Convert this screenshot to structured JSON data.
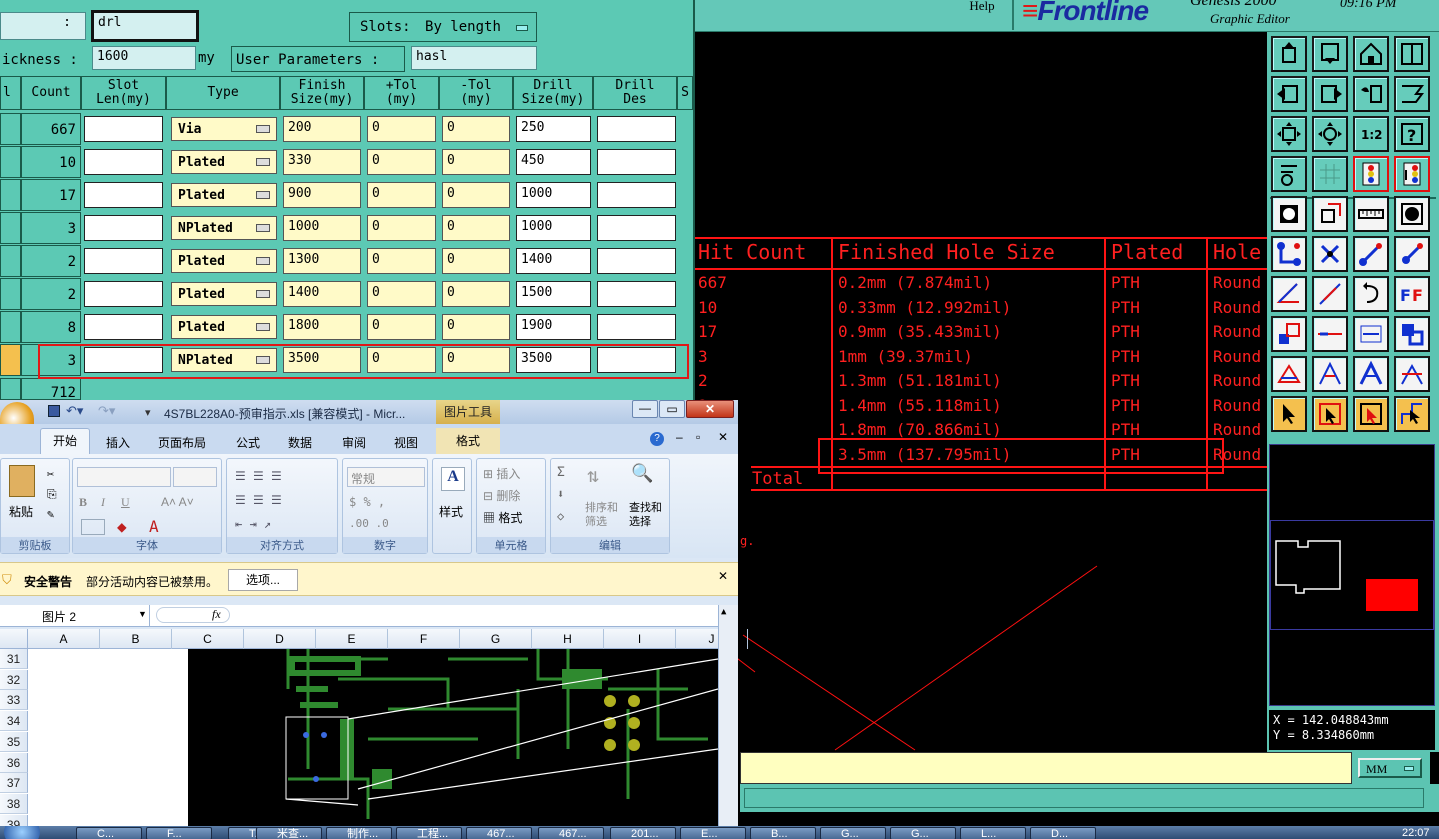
{
  "genesis": {
    "help_label": "Help",
    "logo": "Frontline",
    "app_name": "Genesis 2000",
    "subtitle": "Graphic Editor",
    "clock": "09:16 PM",
    "coord_x": "X = 142.048843mm",
    "coord_y": "Y = 8.334860mm",
    "units": "MM",
    "drill_table": {
      "headers": [
        "Hit Count",
        "Finished Hole Size",
        "Plated",
        "Hole"
      ],
      "rows": [
        [
          "667",
          "0.2mm (7.874mil)",
          "PTH",
          "Round"
        ],
        [
          "10",
          "0.33mm (12.992mil)",
          "PTH",
          "Round"
        ],
        [
          "17",
          "0.9mm (35.433mil)",
          "PTH",
          "Round"
        ],
        [
          "3",
          "1mm (39.37mil)",
          "PTH",
          "Round"
        ],
        [
          "2",
          "1.3mm (51.181mil)",
          "PTH",
          "Round"
        ],
        [
          "2",
          "1.4mm (55.118mil)",
          "PTH",
          "Round"
        ],
        [
          "8",
          "1.8mm (70.866mil)",
          "PTH",
          "Round"
        ],
        [
          "3",
          "3.5mm (137.795mil)",
          "PTH",
          "Round"
        ]
      ],
      "total_label": "Total",
      "stray_text": "g."
    }
  },
  "drill_tools": {
    "layer_label": ":",
    "layer_value": "drl",
    "slots_label": "Slots:",
    "slots_value": "By length",
    "thickness_label": "ickness :",
    "thickness_value": "1600",
    "thickness_unit": "my",
    "user_params_label": "User Parameters :",
    "user_params_value": "hasl",
    "headers": [
      "l",
      "Count",
      "Slot\nLen(my)",
      "Type",
      "Finish\nSize(my)",
      "+Tol\n(my)",
      "-Tol\n(my)",
      "Drill\nSize(my)",
      "Drill\nDes",
      "S"
    ],
    "rows": [
      {
        "count": "667",
        "type": "Via",
        "finish": "200",
        "ptol": "0",
        "ntol": "0",
        "drill": "250"
      },
      {
        "count": "10",
        "type": "Plated",
        "finish": "330",
        "ptol": "0",
        "ntol": "0",
        "drill": "450"
      },
      {
        "count": "17",
        "type": "Plated",
        "finish": "900",
        "ptol": "0",
        "ntol": "0",
        "drill": "1000"
      },
      {
        "count": "3",
        "type": "NPlated",
        "finish": "1000",
        "ptol": "0",
        "ntol": "0",
        "drill": "1000"
      },
      {
        "count": "2",
        "type": "Plated",
        "finish": "1300",
        "ptol": "0",
        "ntol": "0",
        "drill": "1400"
      },
      {
        "count": "2",
        "type": "Plated",
        "finish": "1400",
        "ptol": "0",
        "ntol": "0",
        "drill": "1500"
      },
      {
        "count": "8",
        "type": "Plated",
        "finish": "1800",
        "ptol": "0",
        "ntol": "0",
        "drill": "1900"
      },
      {
        "count": "3",
        "type": "NPlated",
        "finish": "3500",
        "ptol": "0",
        "ntol": "0",
        "drill": "3500"
      }
    ],
    "partial_count": "712"
  },
  "excel": {
    "title": "4S7BL228A0-预审指示.xls [兼容模式] - Micr...",
    "context_tab": "图片工具",
    "tabs": [
      "开始",
      "插入",
      "页面布局",
      "公式",
      "数据",
      "审阅",
      "视图",
      "格式"
    ],
    "groups": {
      "clipboard": "剪贴板",
      "paste": "粘贴",
      "font": "字体",
      "align": "对齐方式",
      "number": "数字",
      "number_format": "常规",
      "styles": "样式",
      "cells": "单元格",
      "insert": "插入",
      "delete": "删除",
      "format": "格式",
      "edit": "编辑",
      "sort": "排序和\n筛选",
      "find": "查找和\n选择"
    },
    "security_title": "安全警告",
    "security_text": "部分活动内容已被禁用。",
    "options_button": "选项...",
    "name_box": "图片 2",
    "fx": "fx",
    "columns": [
      "A",
      "B",
      "C",
      "D",
      "E",
      "F",
      "G",
      "H",
      "I",
      "J"
    ],
    "rows": [
      "31",
      "32",
      "33",
      "34",
      "35",
      "36",
      "37",
      "38",
      "39"
    ]
  },
  "taskbar": {
    "items": [
      "C...",
      "F...",
      "T...",
      "米查...",
      "制作...",
      "工程...",
      "467...",
      "467...",
      "201...",
      "E...",
      "B...",
      "G...",
      "G...",
      "L...",
      "D..."
    ],
    "clock": "22:07"
  }
}
